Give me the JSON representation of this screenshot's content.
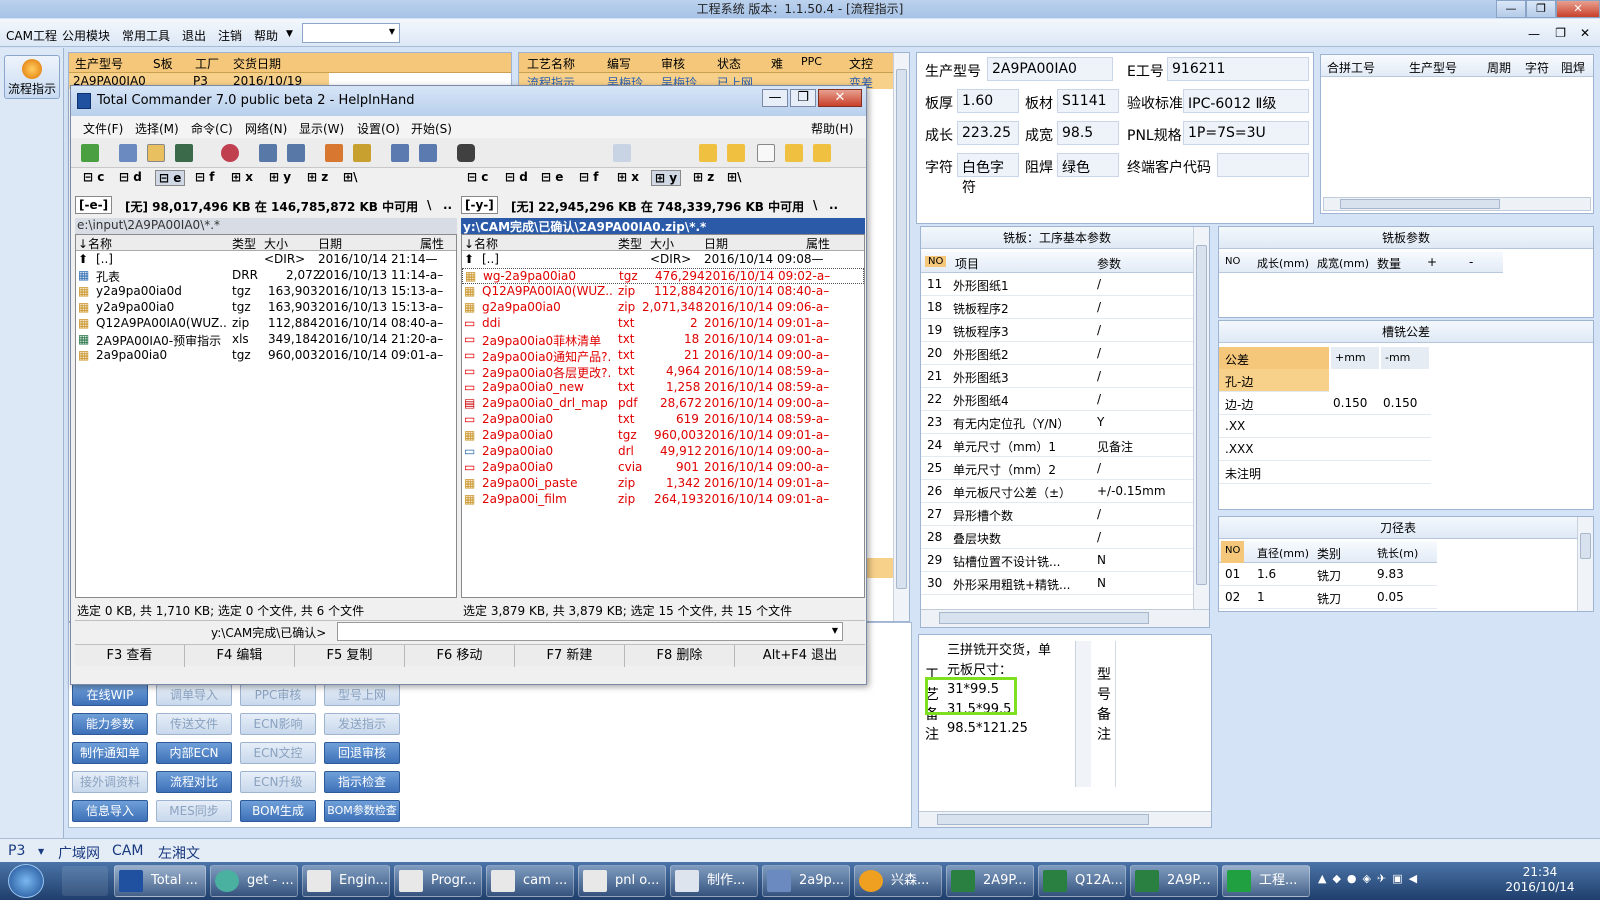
{
  "window": {
    "title": "工程系统   版本：1.1.50.4 - [流程指示]"
  },
  "menu": [
    "CAM工程",
    "公用模块",
    "常用工具",
    "退出",
    "注销",
    "帮助"
  ],
  "nav": {
    "flow_button": "流程指示"
  },
  "left_grid": {
    "headers": [
      "生产型号",
      "S板",
      "工厂",
      "交货日期"
    ],
    "row": [
      "2A9PA00IA0",
      "P3",
      "2016/10/19"
    ]
  },
  "mid_grid": {
    "headers": [
      "工艺名称",
      "编写",
      "审核",
      "状态",
      "难",
      "PPC",
      "文控"
    ],
    "row": [
      "流程指示",
      "吴梅玲",
      "吴梅玲",
      "已上网",
      "",
      "",
      "变差"
    ]
  },
  "info": {
    "model_label": "生产型号",
    "model": "2A9PA00IA0",
    "eno_label": "E工号",
    "eno": "916211",
    "thick_label": "板厚",
    "thick": "1.60",
    "mat_label": "板材",
    "mat": "S1141",
    "std_label": "验收标准",
    "std": "IPC-6012 Ⅱ级",
    "len_label": "成长",
    "len": "223.25",
    "wid_label": "成宽",
    "wid": "98.5",
    "pnl_label": "PNL规格",
    "pnl": "1P=7S=3U",
    "char_label": "字符",
    "char": "白色字符",
    "mask_label": "阻焊",
    "mask": "绿色",
    "cust_label": "终端客户代码",
    "cust": ""
  },
  "merge_grid": {
    "headers": [
      "合拼工号",
      "生产型号",
      "周期",
      "字符",
      "阻焊"
    ]
  },
  "mill_params": {
    "title": "铣板：工序基本参数",
    "headers": [
      "NO",
      "项目",
      "参数"
    ],
    "rows": [
      [
        "11",
        "外形图纸1",
        "/"
      ],
      [
        "18",
        "铣板程序2",
        "/"
      ],
      [
        "19",
        "铣板程序3",
        "/"
      ],
      [
        "20",
        "外形图纸2",
        "/"
      ],
      [
        "21",
        "外形图纸3",
        "/"
      ],
      [
        "22",
        "外形图纸4",
        "/"
      ],
      [
        "23",
        "有无内定位孔（Y/N）",
        "Y"
      ],
      [
        "24",
        "单元尺寸（mm）1",
        "见备注"
      ],
      [
        "25",
        "单元尺寸（mm）2",
        "/"
      ],
      [
        "26",
        "单元板尺寸公差（±）",
        "+/-0.15mm"
      ],
      [
        "27",
        "异形槽个数",
        "/"
      ],
      [
        "28",
        "叠层块数",
        "/"
      ],
      [
        "29",
        "钻槽位置不设计铣...",
        "N"
      ],
      [
        "30",
        "外形采用粗铣+精铣...",
        "N"
      ]
    ]
  },
  "mill_board": {
    "title": "铣板参数",
    "headers": [
      "NO",
      "成长(mm)",
      "成宽(mm)",
      "数量",
      "+",
      "-"
    ]
  },
  "slot_tol": {
    "title": "槽铣公差",
    "headers": [
      "公差",
      "+mm",
      "-mm"
    ],
    "rows": [
      [
        "孔-边",
        "",
        ""
      ],
      [
        "边-边",
        "0.150",
        "0.150"
      ],
      [
        ".XX",
        "",
        ""
      ],
      [
        ".XXX",
        "",
        ""
      ],
      [
        "未注明",
        "",
        ""
      ]
    ]
  },
  "tool_table": {
    "title": "刀径表",
    "headers": [
      "NO",
      "直径(mm)",
      "类别",
      "铣长(m)"
    ],
    "rows": [
      [
        "01",
        "1.6",
        "铣刀",
        "9.83"
      ],
      [
        "02",
        "1",
        "铣刀",
        "0.05"
      ]
    ]
  },
  "remarks": {
    "side_label": "工艺备注",
    "lines": [
      "三拼铣开交货，单",
      "元板尺寸：",
      "31*99.5",
      "31.5*99.5",
      "98.5*121.25"
    ],
    "right_label": "型号备注"
  },
  "action_buttons": [
    [
      "在线WIP",
      "调单导入",
      "PPC审核",
      "型号上网"
    ],
    [
      "能力参数",
      "传送文件",
      "ECN影响",
      "发送指示"
    ],
    [
      "制作通知单",
      "内部ECN",
      "ECN文控",
      "回退审核"
    ],
    [
      "接外调资料",
      "流程对比",
      "ECN升级",
      "指示检查"
    ],
    [
      "信息导入",
      "MES同步",
      "BOM生成",
      "BOM参数检查"
    ]
  ],
  "status": {
    "plant": "P3",
    "tabs": [
      "广域网",
      "CAM",
      "左湘文"
    ]
  },
  "tc": {
    "title": "Total Commander 7.0 public beta 2 - HelpInHand",
    "menu": [
      "文件(F)",
      "选择(M)",
      "命令(C)",
      "网络(N)",
      "显示(W)",
      "设置(O)",
      "开始(S)"
    ],
    "help": "帮助(H)",
    "drives": [
      "c",
      "d",
      "e",
      "f",
      "x",
      "y",
      "z",
      "\\"
    ],
    "left": {
      "drive": "[-e-]",
      "info": "[无] 98,017,496 KB 在 146,785,872 KB 中可用",
      "path": "e:\\input\\2A9PA00IA0\\*.*",
      "headers": [
        "↓名称",
        "类型",
        "大小",
        "日期",
        "属性"
      ],
      "files": [
        [
          "[..]",
          "",
          "<DIR>",
          "2016/10/14 21:14—"
        ],
        [
          "孔表",
          "DRR",
          "2,072",
          "2016/10/13 11:14-a–"
        ],
        [
          "y2a9pa00ia0d",
          "tgz",
          "163,903",
          "2016/10/13 15:13-a–"
        ],
        [
          "y2a9pa00ia0",
          "tgz",
          "163,903",
          "2016/10/13 15:13-a–"
        ],
        [
          "Q12A9PA00IA0(WUZ..",
          "zip",
          "112,884",
          "2016/10/14 08:40-a–"
        ],
        [
          "2A9PA00IA0-预审指示",
          "xls",
          "349,184",
          "2016/10/14 21:20-a–"
        ],
        [
          "2a9pa00ia0",
          "tgz",
          "960,003",
          "2016/10/14 09:01-a–"
        ]
      ],
      "summary": "选定 0 KB, 共 1,710 KB; 选定 0 个文件, 共 6 个文件"
    },
    "right": {
      "drive": "[-y-]",
      "info": "[无] 22,945,296 KB 在 748,339,796 KB 中可用",
      "path": "y:\\CAM完成\\已确认\\2A9PA00IA0.zip\\*.*",
      "headers": [
        "↓名称",
        "类型",
        "大小",
        "日期",
        "属性"
      ],
      "files": [
        [
          "[..]",
          "",
          "<DIR>",
          "2016/10/14 09:08—"
        ],
        [
          "wg-2a9pa00ia0",
          "tgz",
          "476,294",
          "2016/10/14 09:02-a–"
        ],
        [
          "Q12A9PA00IA0(WUZ..",
          "zip",
          "112,884",
          "2016/10/14 08:40-a–"
        ],
        [
          "g2a9pa00ia0",
          "zip",
          "2,071,348",
          "2016/10/14 09:06-a–"
        ],
        [
          "ddi",
          "txt",
          "2",
          "2016/10/14 09:01-a–"
        ],
        [
          "2a9pa00ia0菲林清单",
          "txt",
          "18",
          "2016/10/14 09:01-a–"
        ],
        [
          "2a9pa00ia0通知产品?.",
          "txt",
          "21",
          "2016/10/14 09:00-a–"
        ],
        [
          "2a9pa00ia0各层更改?.",
          "txt",
          "4,964",
          "2016/10/14 08:59-a–"
        ],
        [
          "2a9pa00ia0_new",
          "txt",
          "1,258",
          "2016/10/14 08:59-a–"
        ],
        [
          "2a9pa00ia0_drl_map",
          "pdf",
          "28,672",
          "2016/10/14 09:00-a–"
        ],
        [
          "2a9pa00ia0",
          "txt",
          "619",
          "2016/10/14 08:59-a–"
        ],
        [
          "2a9pa00ia0",
          "tgz",
          "960,003",
          "2016/10/14 09:01-a–"
        ],
        [
          "2a9pa00ia0",
          "drl",
          "49,912",
          "2016/10/14 09:00-a–"
        ],
        [
          "2a9pa00ia0",
          "cvia",
          "901",
          "2016/10/14 09:00-a–"
        ],
        [
          "2a9pa00i_paste",
          "zip",
          "1,342",
          "2016/10/14 09:01-a–"
        ],
        [
          "2a9pa00i_film",
          "zip",
          "264,193",
          "2016/10/14 09:01-a–"
        ]
      ],
      "summary": "选定 3,879 KB, 共 3,879 KB; 选定 15 个文件, 共 15 个文件"
    },
    "cmd_path": "y:\\CAM完成\\已确认>",
    "fkeys": [
      "F3 查看",
      "F4 编辑",
      "F5 复制",
      "F6 移动",
      "F7 新建",
      "F8 删除",
      "Alt+F4 退出"
    ]
  },
  "taskbar": {
    "tasks": [
      "Total ...",
      "get - ...",
      "Engin...",
      "Progr...",
      "cam ...",
      "pnl o...",
      "制作...",
      "2a9p...",
      "兴森...",
      "2A9P...",
      "Q12A...",
      "2A9P...",
      "工程..."
    ],
    "time": "21:34",
    "date": "2016/10/14"
  }
}
